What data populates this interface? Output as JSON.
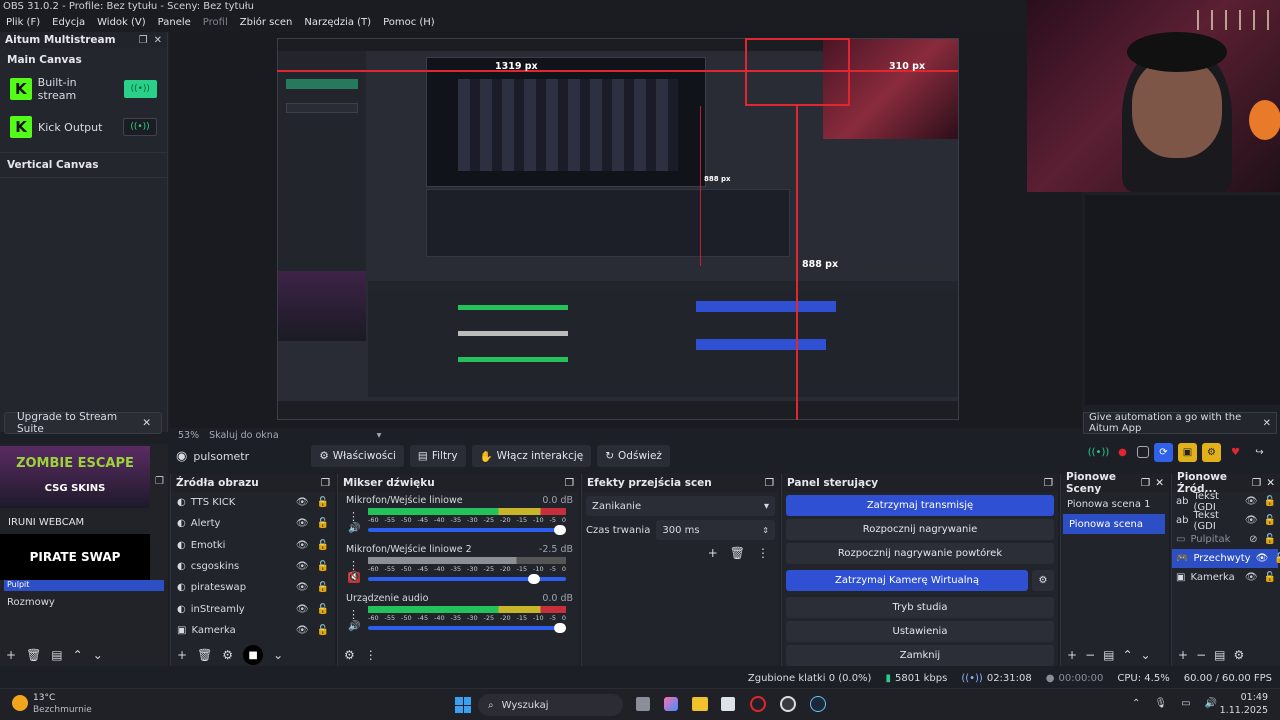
{
  "window": {
    "title": "OBS 31.0.2 - Profile: Bez tytułu - Sceny: Bez tytułu"
  },
  "menu": [
    "Plik (F)",
    "Edycja",
    "Widok (V)",
    "Panele",
    "Profil",
    "Zbiór scen",
    "Narzędzia (T)",
    "Pomoc (H)"
  ],
  "altum": {
    "title": "Aitum Multistream",
    "main_canvas": "Main Canvas",
    "outputs": [
      {
        "label": "Built-in stream",
        "active": true
      },
      {
        "label": "Kick Output",
        "active": false
      }
    ],
    "vertical_canvas": "Vertical Canvas",
    "upgrade": "Upgrade to Stream Suite"
  },
  "preview": {
    "measure_top": "1319 px",
    "measure_right_top": "310 px",
    "measure_mid": "888 px",
    "measure_bottom": "888 px"
  },
  "automation": "Give automation a go with the Aitum App",
  "zoom": {
    "level": "53%",
    "mode": "Skaluj do okna"
  },
  "source_toolbar": {
    "selected_source": "pulsometr",
    "buttons": [
      "Właściwości",
      "Filtry",
      "Włącz interakcję",
      "Odśwież"
    ]
  },
  "scenes_panel": {
    "scene_names": [
      "Pulpit",
      "Rozmowy"
    ],
    "overlay_labels": [
      "ZOMBIE ESCAPE",
      "CSG SKINS",
      "IRUNI WEBCAM",
      "PIRATE SWAP"
    ]
  },
  "sources": {
    "title": "Źródła obrazu",
    "items": [
      "TTS KICK",
      "Alerty",
      "Emotki",
      "csgoskins",
      "pirateswap",
      "inStreamly",
      "Kamerka"
    ]
  },
  "mixer": {
    "title": "Mikser dźwięku",
    "channels": [
      {
        "name": "Mikrofon/Wejście liniowe",
        "db": "0.0 dB",
        "level": 1.0,
        "muted": false
      },
      {
        "name": "Mikrofon/Wejście liniowe 2",
        "db": "-2.5 dB",
        "level": 0.86,
        "muted": true
      },
      {
        "name": "Urządzenie audio",
        "db": "0.0 dB",
        "level": 1.0,
        "muted": false
      }
    ],
    "ticks": [
      "-60",
      "-55",
      "-50",
      "-45",
      "-40",
      "-35",
      "-30",
      "-25",
      "-20",
      "-15",
      "-10",
      "-5",
      "0"
    ]
  },
  "transitions": {
    "title": "Efekty przejścia scen",
    "selected": "Zanikanie",
    "duration_label": "Czas trwania",
    "duration_value": "300 ms"
  },
  "controls": {
    "title": "Panel sterujący",
    "buttons": [
      "Zatrzymaj transmisję",
      "Rozpocznij nagrywanie",
      "Rozpocznij nagrywanie powtórek",
      "Zatrzymaj Kamerę Wirtualną",
      "Tryb studia",
      "Ustawienia",
      "Zamknij"
    ]
  },
  "vertical_scenes": {
    "title": "Pionowe Sceny",
    "items": [
      "Pionowa scena 1",
      "Pionowa scena"
    ]
  },
  "vertical_sources": {
    "title": "Pionowe Źród...",
    "items": [
      "Tekst (GDI",
      "Tekst (GDI",
      "Pulpitak",
      "Przechwyty",
      "Kamerka"
    ]
  },
  "status": {
    "dropped": "Zgubione klatki 0 (0.0%)",
    "bitrate": "5801 kbps",
    "stream_time": "02:31:08",
    "rec_time": "00:00:00",
    "cpu": "CPU: 4.5%",
    "fps": "60.00 / 60.00 FPS"
  },
  "taskbar": {
    "temp": "13°C",
    "weather": "Bezchmurnie",
    "search": "Wyszukaj",
    "time": "01:49",
    "date": "1.11.2025"
  }
}
